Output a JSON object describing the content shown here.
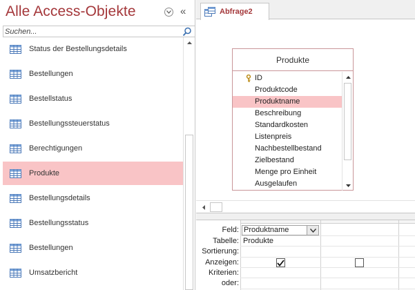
{
  "nav": {
    "title": "Alle Access-Objekte",
    "dropdown_icon": "chevron-down-circle-icon",
    "collapse_label": "«",
    "search": {
      "placeholder": "Suchen...",
      "value": ""
    },
    "items": [
      {
        "label": "Status der Bestellungsdetails",
        "icon": "table-icon",
        "selected": false
      },
      {
        "label": "Bestellungen",
        "icon": "table-icon",
        "selected": false
      },
      {
        "label": "Bestellstatus",
        "icon": "table-icon",
        "selected": false
      },
      {
        "label": "Bestellungssteuerstatus",
        "icon": "table-icon",
        "selected": false
      },
      {
        "label": "Berechtigungen",
        "icon": "table-icon",
        "selected": false
      },
      {
        "label": "Produkte",
        "icon": "table-icon",
        "selected": true
      },
      {
        "label": "Bestellungsdetails",
        "icon": "table-icon",
        "selected": false
      },
      {
        "label": "Bestellungsstatus",
        "icon": "table-icon",
        "selected": false
      },
      {
        "label": "Bestellungen",
        "icon": "table-icon",
        "selected": false
      },
      {
        "label": "Umsatzbericht",
        "icon": "table-icon",
        "selected": false
      }
    ]
  },
  "tab": {
    "label": "Abfrage2",
    "icon": "query-icon"
  },
  "field_list": {
    "title": "Produkte",
    "fields": [
      {
        "label": "ID",
        "key": true,
        "selected": false
      },
      {
        "label": "Produktcode",
        "key": false,
        "selected": false
      },
      {
        "label": "Produktname",
        "key": false,
        "selected": true
      },
      {
        "label": "Beschreibung",
        "key": false,
        "selected": false
      },
      {
        "label": "Standardkosten",
        "key": false,
        "selected": false
      },
      {
        "label": "Listenpreis",
        "key": false,
        "selected": false
      },
      {
        "label": "Nachbestellbestand",
        "key": false,
        "selected": false
      },
      {
        "label": "Zielbestand",
        "key": false,
        "selected": false
      },
      {
        "label": "Menge pro Einheit",
        "key": false,
        "selected": false
      },
      {
        "label": "Ausgelaufen",
        "key": false,
        "selected": false
      }
    ]
  },
  "grid": {
    "row_labels": [
      "Feld:",
      "Tabelle:",
      "Sortierung:",
      "Anzeigen:",
      "Kriterien:",
      "oder:"
    ],
    "columns": [
      {
        "field": "Produktname",
        "table": "Produkte",
        "show": true
      },
      {
        "field": "",
        "table": "",
        "show": false
      }
    ]
  },
  "colors": {
    "accent": "#a4373a",
    "selection": "#f9c4c6"
  }
}
